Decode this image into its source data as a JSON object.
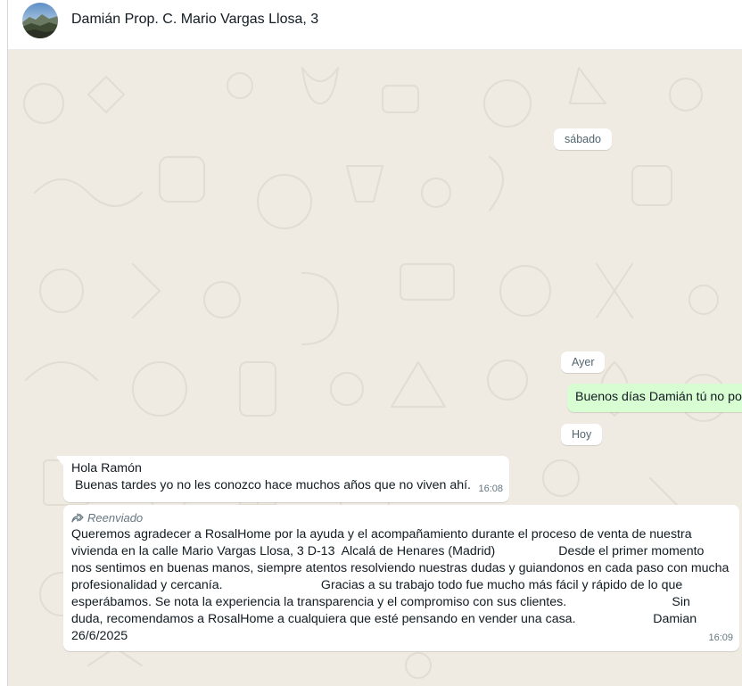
{
  "header": {
    "contact_name": "Damián Prop. C. Mario Vargas Llosa, 3"
  },
  "colors": {
    "chat_background": "#efeae2",
    "incoming_bubble": "#ffffff",
    "outgoing_bubble": "#d9fdd3",
    "timestamp_text": "#667781"
  },
  "days": {
    "saturday": "sábado",
    "yesterday": "Ayer",
    "today": "Hoy"
  },
  "messages": [
    {
      "direction": "out",
      "text": "Buenos días Damián tú no po"
    },
    {
      "direction": "in",
      "line1": "Hola Ramón",
      "line2": " Buenas tardes yo no les conozco hace muchos años que no viven ahí.",
      "time": "16:08"
    },
    {
      "direction": "in",
      "forwarded_label": "Reenviado",
      "lines": [
        "Queremos agradecer a RosalHome por la ayuda y el acompañamiento durante el proceso de venta de nuestra",
        "vivienda en la calle Mario Vargas Llosa, 3 D-13  Alcalá de Henares (Madrid)                  Desde el primer momento",
        "nos sentimos en buenas manos, siempre atentos resolviendo nuestras dudas y guiandonos en cada paso con mucha",
        "profesionalidad y cercanía.                            Gracias a su trabajo todo fue mucho más fácil y rápido de lo que",
        "esperábamos. Se nota la experiencia la transparencia y el compromiso con sus clientes.                              Sin",
        "duda, recomendamos a RosalHome a cualquiera que esté pensando en vender una casa.                      Damian",
        "26/6/2025"
      ],
      "time": "16:09"
    }
  ]
}
